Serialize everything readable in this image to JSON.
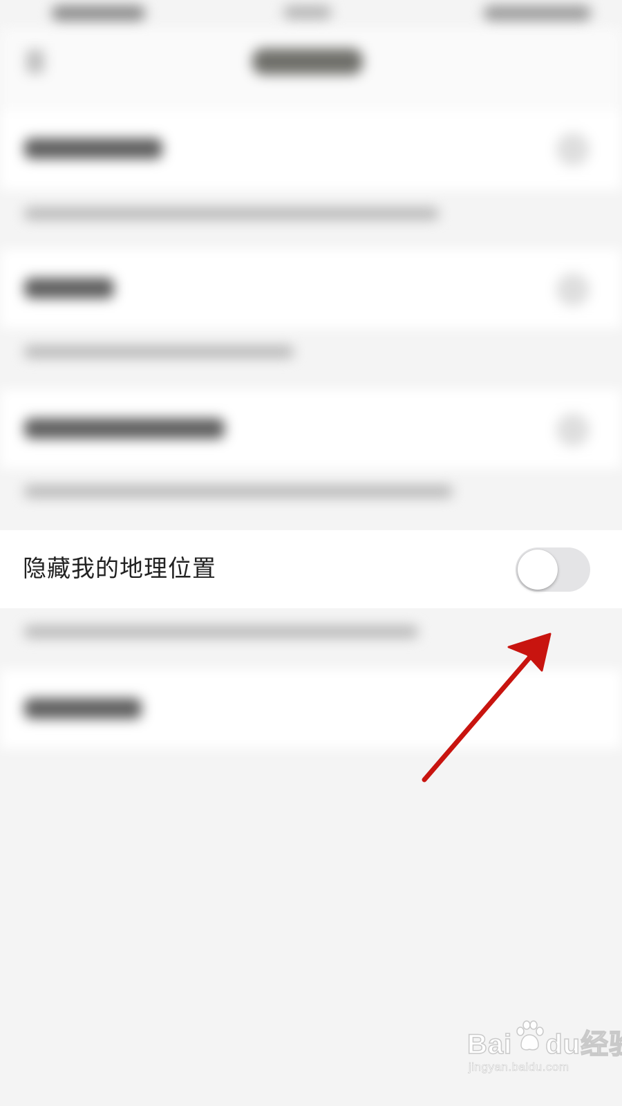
{
  "setting": {
    "label": "隐藏我的地理位置",
    "toggle_on": false
  },
  "watermark": {
    "brand": "Bai",
    "brand_suffix": "经验",
    "url": "jingyan.baidu.com"
  },
  "colors": {
    "annotation_arrow": "#c8140f",
    "toggle_track_off": "#e4e4e6",
    "toggle_knob": "#ffffff",
    "row_background": "#ffffff",
    "page_background": "#f4f4f4"
  },
  "icons": {
    "toggle": "toggle-switch-off",
    "annotation": "red-arrow",
    "watermark_logo": "baidu-paw-logo"
  }
}
